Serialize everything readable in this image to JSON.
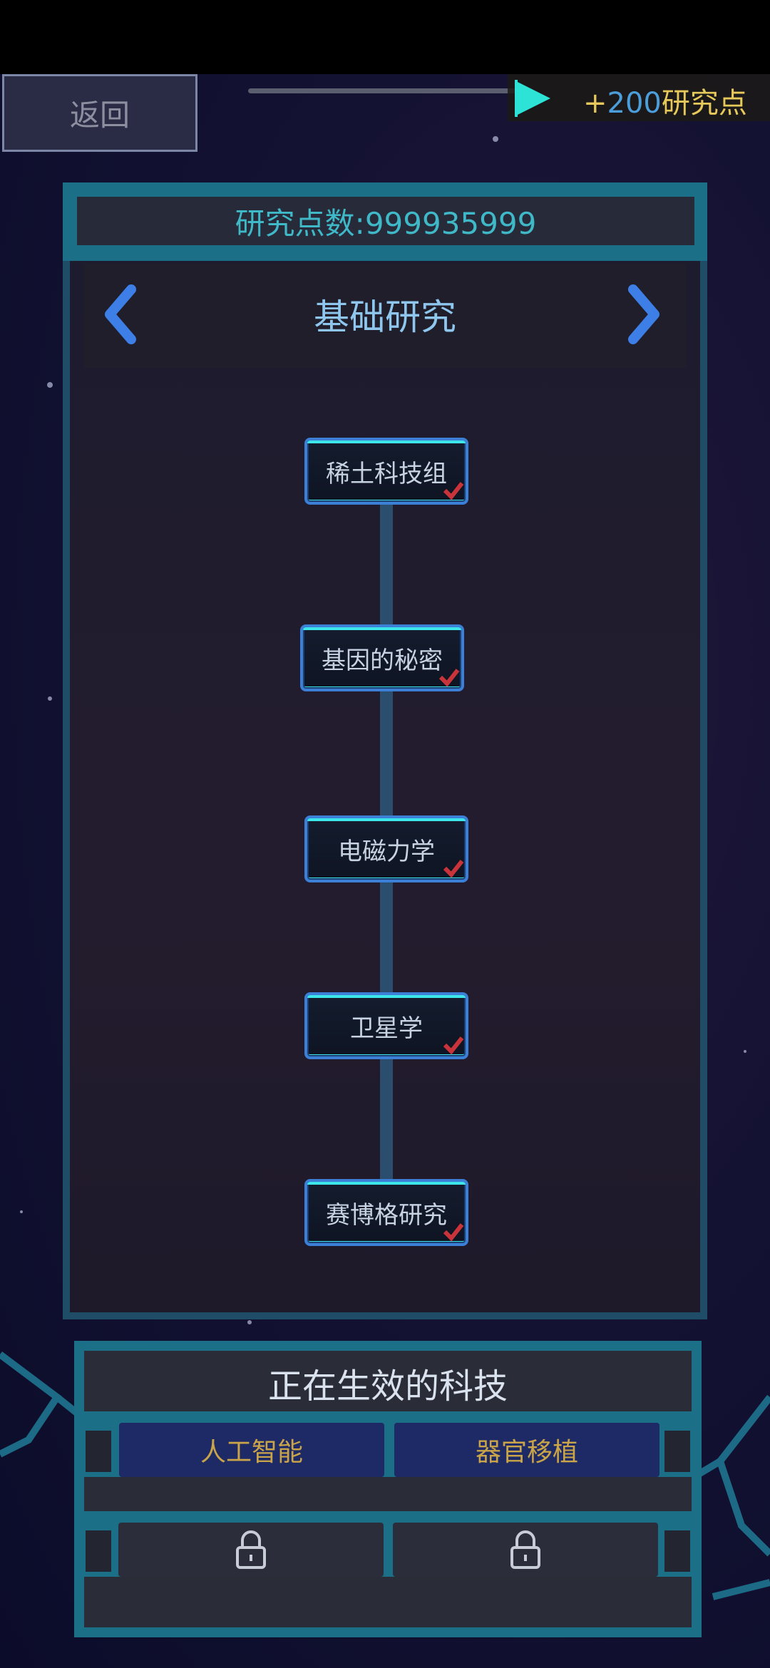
{
  "top_bar": {
    "back_label": "返回",
    "reward_prefix": "+",
    "reward_amount": "200",
    "reward_suffix": "研究点"
  },
  "research": {
    "points_label": "研究点数:999935999",
    "category_title": "基础研究",
    "nodes": [
      {
        "label": "稀土科技组",
        "completed": true
      },
      {
        "label": "基因的秘密",
        "completed": true
      },
      {
        "label": "电磁力学",
        "completed": true
      },
      {
        "label": "卫星学",
        "completed": true
      },
      {
        "label": "赛博格研究",
        "completed": true
      }
    ]
  },
  "active_tech": {
    "title": "正在生效的科技",
    "slots": [
      {
        "label": "人工智能",
        "state": "active"
      },
      {
        "label": "器官移植",
        "state": "active"
      },
      {
        "label": "",
        "state": "locked"
      },
      {
        "label": "",
        "state": "locked"
      }
    ]
  },
  "colors": {
    "accent_cyan": "#3de6e8",
    "node_border": "#3b7fd6",
    "check_red": "#c8343a",
    "reward_gold": "#e6c95a",
    "slot_text_gold": "#c9a448"
  }
}
